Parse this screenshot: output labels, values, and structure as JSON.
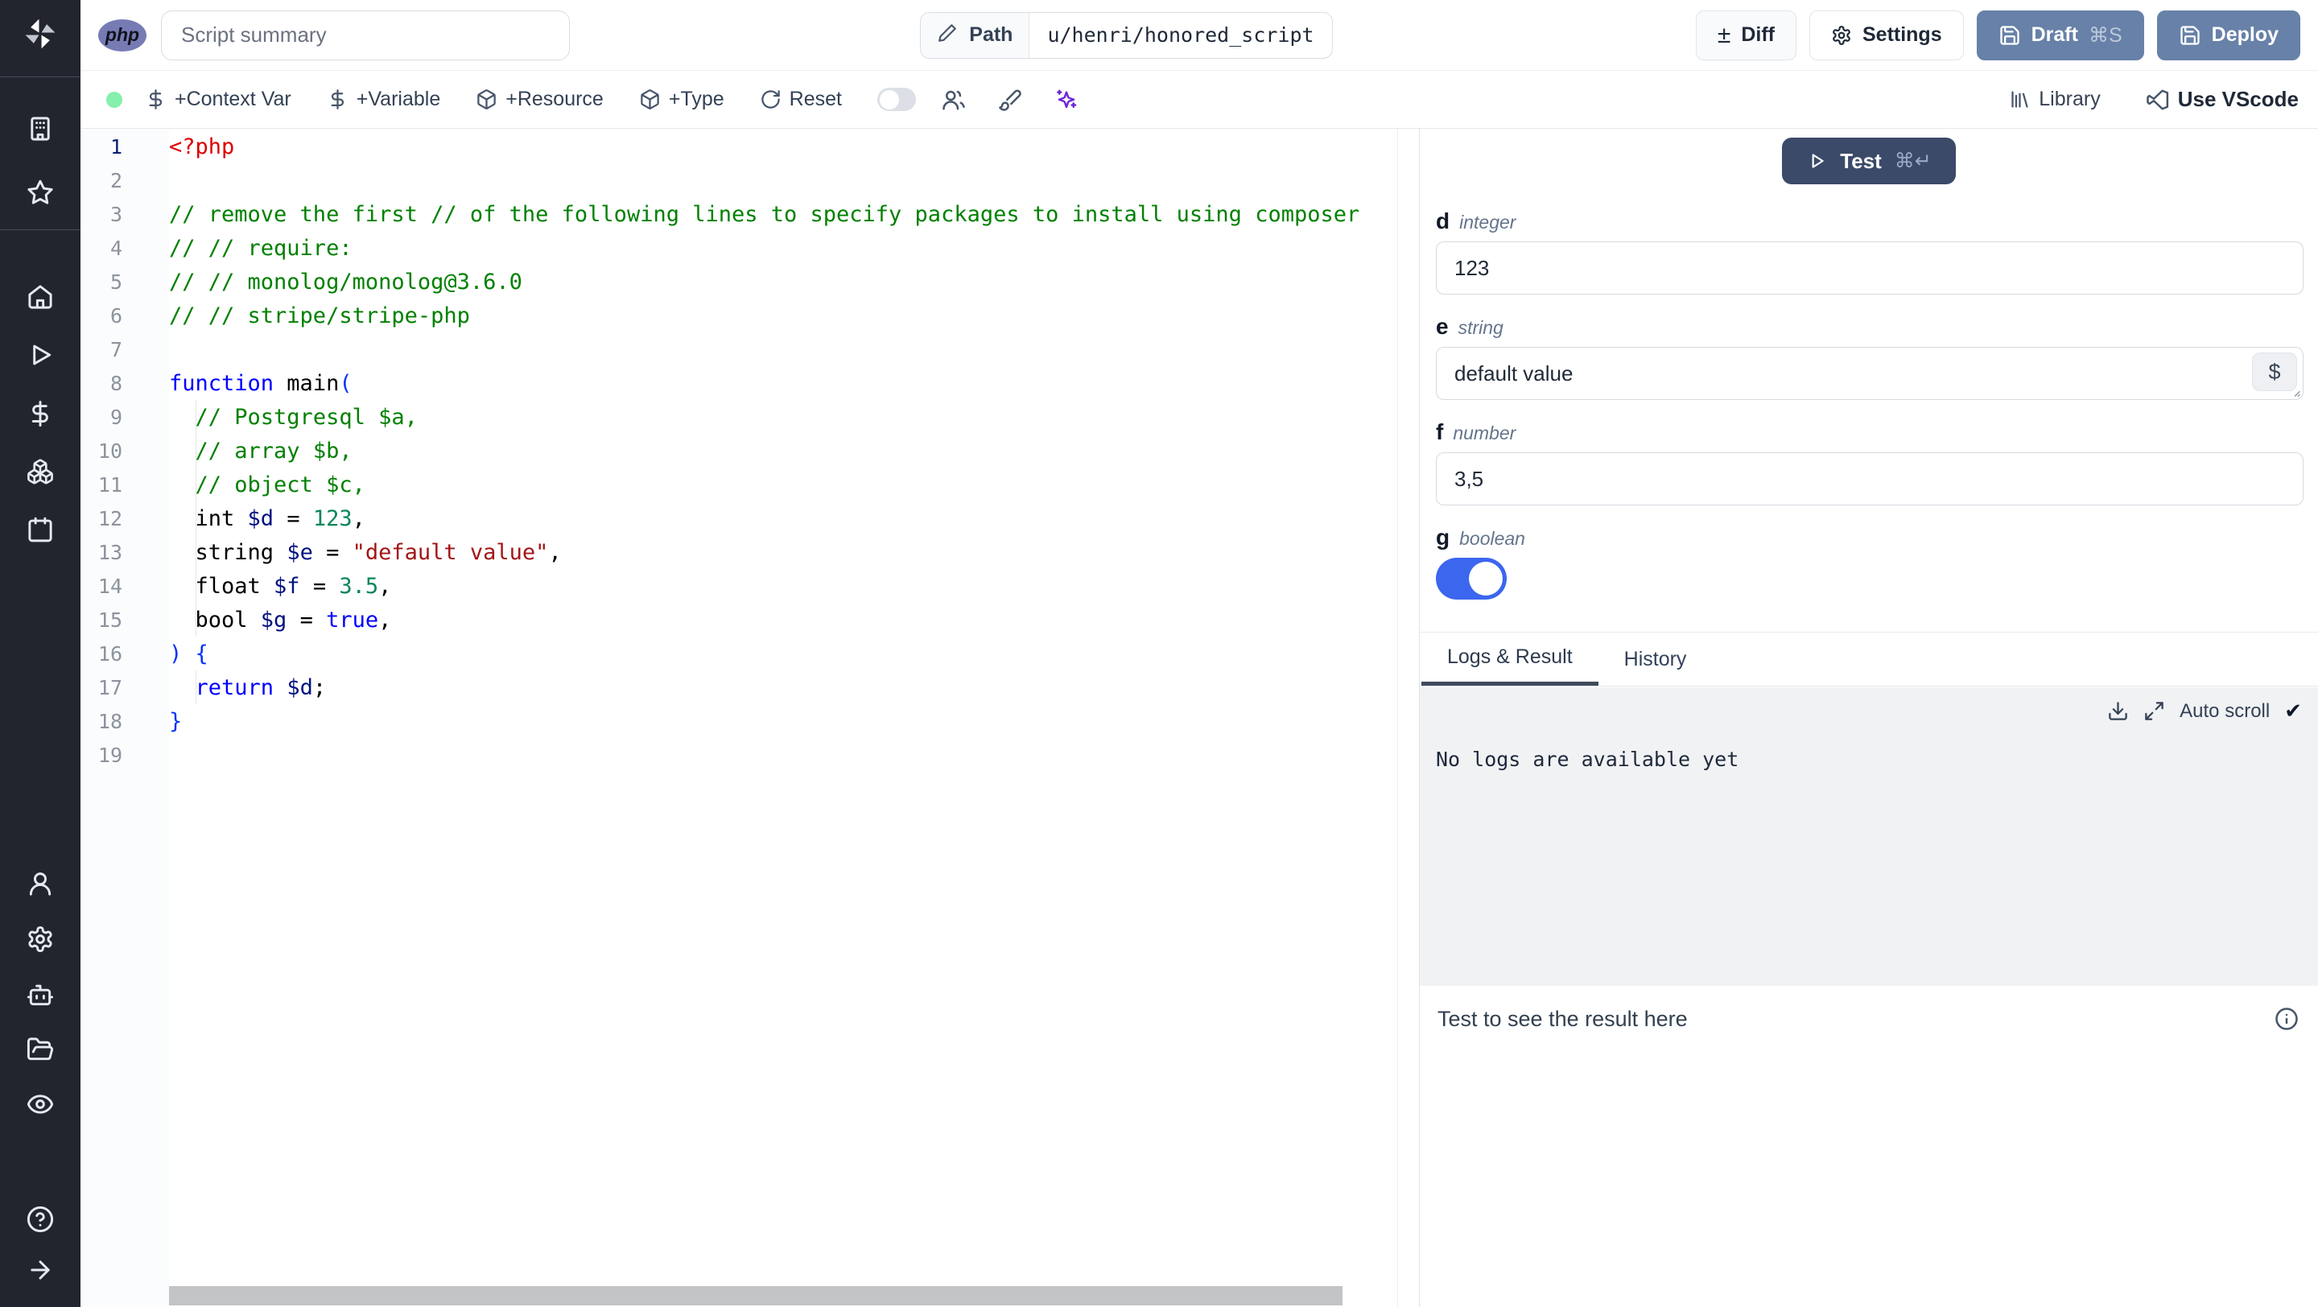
{
  "header": {
    "language_badge": "php",
    "summary_placeholder": "Script summary",
    "path_label": "Path",
    "path_value": "u/henri/honored_script",
    "diff_label": "Diff",
    "settings_label": "Settings",
    "draft_label": "Draft",
    "draft_shortcut": "⌘S",
    "deploy_label": "Deploy"
  },
  "toolbar": {
    "add_context_var": "+Context Var",
    "add_variable": "+Variable",
    "add_resource": "+Resource",
    "add_type": "+Type",
    "reset": "Reset",
    "library": "Library",
    "use_vscode": "Use VScode"
  },
  "editor": {
    "active_line": 1,
    "language": "php",
    "lines": [
      {
        "n": 1,
        "tokens": [
          [
            "metatag",
            "<?php"
          ]
        ]
      },
      {
        "n": 2,
        "tokens": []
      },
      {
        "n": 3,
        "tokens": [
          [
            "comment",
            "// remove the first // of the following lines to specify packages to install using composer"
          ]
        ]
      },
      {
        "n": 4,
        "tokens": [
          [
            "comment",
            "// // require:"
          ]
        ]
      },
      {
        "n": 5,
        "tokens": [
          [
            "comment",
            "// // monolog/monolog@3.6.0"
          ]
        ]
      },
      {
        "n": 6,
        "tokens": [
          [
            "comment",
            "// // stripe/stripe-php"
          ]
        ]
      },
      {
        "n": 7,
        "tokens": []
      },
      {
        "n": 8,
        "tokens": [
          [
            "keyword",
            "function"
          ],
          [
            "plain",
            " main"
          ],
          [
            "paren",
            "("
          ]
        ]
      },
      {
        "n": 9,
        "tokens": [
          [
            "plain",
            "  "
          ],
          [
            "comment",
            "// Postgresql $a,"
          ]
        ]
      },
      {
        "n": 10,
        "tokens": [
          [
            "plain",
            "  "
          ],
          [
            "comment",
            "// array $b,"
          ]
        ]
      },
      {
        "n": 11,
        "tokens": [
          [
            "plain",
            "  "
          ],
          [
            "comment",
            "// object $c,"
          ]
        ]
      },
      {
        "n": 12,
        "tokens": [
          [
            "plain",
            "  int "
          ],
          [
            "variable",
            "$d"
          ],
          [
            "plain",
            " = "
          ],
          [
            "number",
            "123"
          ],
          [
            "plain",
            ","
          ]
        ]
      },
      {
        "n": 13,
        "tokens": [
          [
            "plain",
            "  string "
          ],
          [
            "variable",
            "$e"
          ],
          [
            "plain",
            " = "
          ],
          [
            "string",
            "\"default value\""
          ],
          [
            "plain",
            ","
          ]
        ]
      },
      {
        "n": 14,
        "tokens": [
          [
            "plain",
            "  float "
          ],
          [
            "variable",
            "$f"
          ],
          [
            "plain",
            " = "
          ],
          [
            "number",
            "3.5"
          ],
          [
            "plain",
            ","
          ]
        ]
      },
      {
        "n": 15,
        "tokens": [
          [
            "plain",
            "  bool "
          ],
          [
            "variable",
            "$g"
          ],
          [
            "plain",
            " = "
          ],
          [
            "keyword",
            "true"
          ],
          [
            "plain",
            ","
          ]
        ]
      },
      {
        "n": 16,
        "tokens": [
          [
            "paren",
            ") {"
          ]
        ]
      },
      {
        "n": 17,
        "tokens": [
          [
            "plain",
            "  "
          ],
          [
            "keyword",
            "return"
          ],
          [
            "plain",
            " "
          ],
          [
            "variable",
            "$d"
          ],
          [
            "plain",
            ";"
          ]
        ]
      },
      {
        "n": 18,
        "tokens": [
          [
            "paren",
            "}"
          ]
        ]
      },
      {
        "n": 19,
        "tokens": []
      }
    ]
  },
  "panel": {
    "test_label": "Test",
    "test_shortcut": "⌘↵",
    "args": {
      "d": {
        "name": "d",
        "type": "integer",
        "value": "123"
      },
      "e": {
        "name": "e",
        "type": "string",
        "value": "default value",
        "button": "$"
      },
      "f": {
        "name": "f",
        "type": "number",
        "value": "3,5"
      },
      "g": {
        "name": "g",
        "type": "boolean",
        "value": "on"
      }
    },
    "tabs": {
      "logs": "Logs & Result",
      "history": "History"
    },
    "logs": {
      "auto_scroll_label": "Auto scroll",
      "check": "✔",
      "empty_message": "No logs are available yet"
    },
    "result_placeholder": "Test to see the result here"
  },
  "colors": {
    "accent_button": "#6781a8",
    "test_button": "#3b4a68",
    "toggle_on": "#3b66ee",
    "php_badge": "#777bb4",
    "status_dot": "#86efac"
  }
}
